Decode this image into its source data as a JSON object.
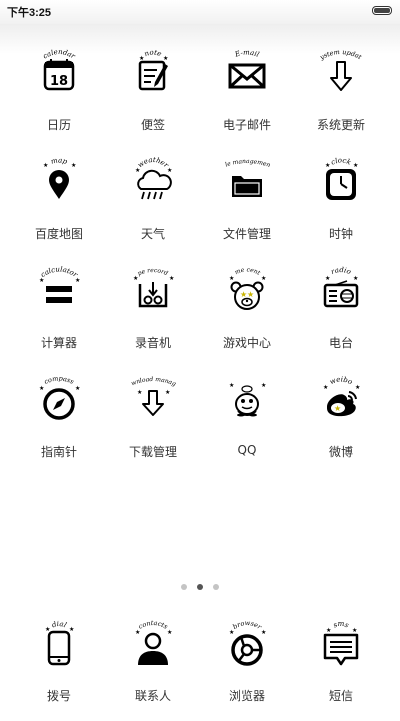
{
  "status_bar": {
    "time": "下午3:25"
  },
  "page_indicator": {
    "count": 3,
    "active_index": 1
  },
  "apps": [
    {
      "id": "calendar",
      "label": "日历",
      "icon": "calendar-icon",
      "icon_caption": "calendar",
      "icon_number": "18"
    },
    {
      "id": "notes",
      "label": "便签",
      "icon": "note-icon",
      "icon_caption": "note"
    },
    {
      "id": "email",
      "label": "电子邮件",
      "icon": "envelope-icon",
      "icon_caption": "E-mail"
    },
    {
      "id": "system-update",
      "label": "系统更新",
      "icon": "arrow-down-icon",
      "icon_caption": "system update"
    },
    {
      "id": "baidu-map",
      "label": "百度地图",
      "icon": "map-pin-icon",
      "icon_caption": "map"
    },
    {
      "id": "weather",
      "label": "天气",
      "icon": "cloud-rain-icon",
      "icon_caption": "weather"
    },
    {
      "id": "file-manager",
      "label": "文件管理",
      "icon": "folder-icon",
      "icon_caption": "file management"
    },
    {
      "id": "clock",
      "label": "时钟",
      "icon": "clock-icon",
      "icon_caption": "clock"
    },
    {
      "id": "calculator",
      "label": "计算器",
      "icon": "equals-icon",
      "icon_caption": "calculator"
    },
    {
      "id": "recorder",
      "label": "录音机",
      "icon": "tape-recorder-icon",
      "icon_caption": "tape recorder"
    },
    {
      "id": "game-center",
      "label": "游戏中心",
      "icon": "bear-face-icon",
      "icon_caption": "game center"
    },
    {
      "id": "radio",
      "label": "电台",
      "icon": "radio-icon",
      "icon_caption": "radio"
    },
    {
      "id": "compass",
      "label": "指南针",
      "icon": "compass-icon",
      "icon_caption": "compass"
    },
    {
      "id": "download-manager",
      "label": "下载管理",
      "icon": "download-arrow-icon",
      "icon_caption": "download manager"
    },
    {
      "id": "qq",
      "label": "QQ",
      "icon": "penguin-icon",
      "icon_caption": ""
    },
    {
      "id": "weibo",
      "label": "微博",
      "icon": "weibo-icon",
      "icon_caption": "weibo"
    }
  ],
  "dock": [
    {
      "id": "dialer",
      "label": "拨号",
      "icon": "phone-icon",
      "icon_caption": "dial"
    },
    {
      "id": "contacts",
      "label": "联系人",
      "icon": "person-icon",
      "icon_caption": "contacts"
    },
    {
      "id": "browser",
      "label": "浏览器",
      "icon": "browser-icon",
      "icon_caption": "browser"
    },
    {
      "id": "sms",
      "label": "短信",
      "icon": "message-icon",
      "icon_caption": "sms"
    }
  ]
}
